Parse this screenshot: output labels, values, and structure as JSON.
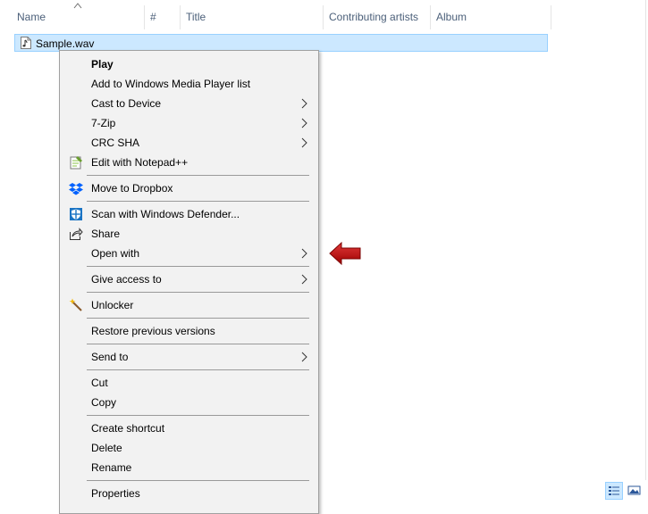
{
  "columns": {
    "name": "Name",
    "number": "#",
    "title": "Title",
    "contributing_artists": "Contributing artists",
    "album": "Album"
  },
  "file": {
    "name": "Sample.wav",
    "icon": "audio-file-icon"
  },
  "menu": {
    "play": "Play",
    "add_wmp": "Add to Windows Media Player list",
    "cast": "Cast to Device",
    "zip": "7-Zip",
    "crc": "CRC SHA",
    "notepad": "Edit with Notepad++",
    "dropbox": "Move to Dropbox",
    "defender": "Scan with Windows Defender...",
    "share": "Share",
    "open_with": "Open with",
    "give_access": "Give access to",
    "unlocker": "Unlocker",
    "restore": "Restore previous versions",
    "send_to": "Send to",
    "cut": "Cut",
    "copy": "Copy",
    "create_shortcut": "Create shortcut",
    "delete": "Delete",
    "rename": "Rename",
    "properties": "Properties"
  },
  "colors": {
    "selection": "#cce8ff",
    "selection_border": "#99d1ff",
    "menu_bg": "#f2f2f2",
    "header_text": "#4c607a",
    "annotation_arrow": "#c00000",
    "dropbox_blue": "#0061fe",
    "defender_blue": "#1a74c4"
  }
}
